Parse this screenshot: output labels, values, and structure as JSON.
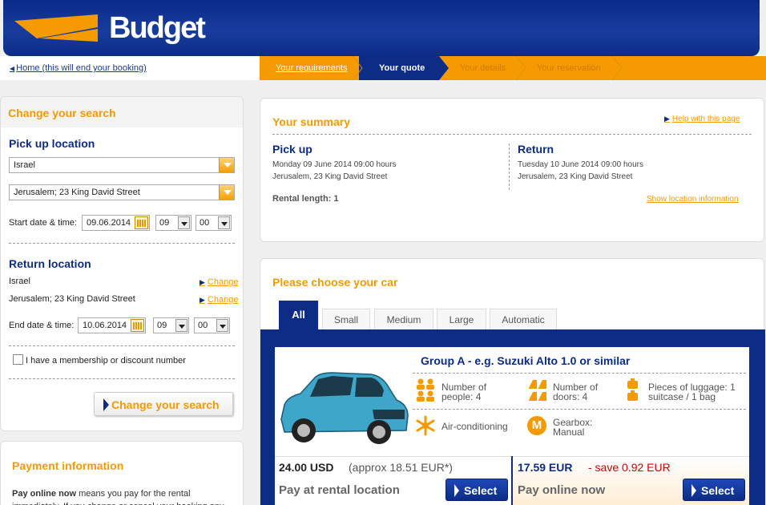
{
  "brand": {
    "logo_text": "Budget",
    "accent": "#f59a00",
    "navy": "#0c2c86"
  },
  "nav": {
    "home_link": "Home (this will end your booking)",
    "steps": [
      {
        "label": "Your requirements",
        "state": "link"
      },
      {
        "label": "Your quote",
        "state": "active"
      },
      {
        "label": "Your details",
        "state": "disabled"
      },
      {
        "label": "Your reservation",
        "state": "disabled"
      }
    ]
  },
  "search": {
    "title": "Change your search",
    "pickup": {
      "heading": "Pick up location",
      "country": "Israel",
      "location": "Jerusalem; 23 King David Street",
      "date_label": "Start date & time:",
      "date": "09.06.2014",
      "hour": "09",
      "minute": "00"
    },
    "return": {
      "heading": "Return location",
      "country": "Israel",
      "location": "Jerusalem; 23 King David Street",
      "change_label": "Change",
      "date_label": "End date & time:",
      "date": "10.06.2014",
      "hour": "09",
      "minute": "00"
    },
    "membership_label": "I have a membership or discount number",
    "membership_checked": false,
    "submit_label": "Change your search"
  },
  "payment": {
    "title": "Payment information",
    "text_bold": "Pay online now",
    "text_rest": " means you pay for the rental immediately. If you change or cancel your booking any"
  },
  "summary": {
    "title": "Your summary",
    "help_link": "Help with this page",
    "pickup": {
      "heading": "Pick up",
      "datetime": "Monday 09 June 2014 09:00 hours",
      "location": "Jerusalem, 23 King David Street"
    },
    "return": {
      "heading": "Return",
      "datetime": "Tuesday 10 June 2014 09:00 hours",
      "location": "Jerusalem, 23 King David Street"
    },
    "rental_length_label": "Rental length:",
    "rental_length": "1",
    "location_link": "Show location information"
  },
  "cars": {
    "title": "Please choose your car",
    "tabs": [
      "All",
      "Small",
      "Medium",
      "Large",
      "Automatic"
    ],
    "active_tab": "All",
    "card": {
      "group": "Group A - e.g. Suzuki Alto 1.0 or similar",
      "features": {
        "people_label": "Number of people: 4",
        "doors_label": "Number of doors: 4",
        "luggage_label": "Pieces of luggage: 1 suitcase / 1 bag",
        "aircon_label": "Air-conditioning",
        "gearbox_label": "Gearbox: Manual",
        "gearbox_letter": "M"
      },
      "pay_later": {
        "price": "24.00 USD",
        "approx": "(approx 18.51 EUR*)",
        "mode": "Pay at rental location",
        "button": "Select"
      },
      "pay_now": {
        "price": "17.59 EUR",
        "save": "- save 0.92 EUR",
        "mode": "Pay online now",
        "button": "Select"
      }
    }
  }
}
